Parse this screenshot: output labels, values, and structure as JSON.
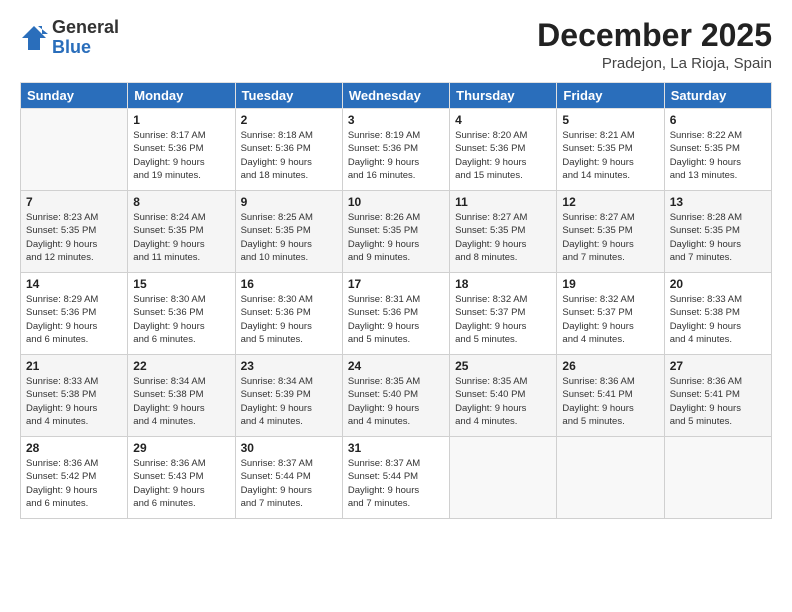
{
  "header": {
    "logo": {
      "line1": "General",
      "line2": "Blue"
    },
    "title": "December 2025",
    "location": "Pradejon, La Rioja, Spain"
  },
  "weekdays": [
    "Sunday",
    "Monday",
    "Tuesday",
    "Wednesday",
    "Thursday",
    "Friday",
    "Saturday"
  ],
  "weeks": [
    [
      {
        "day": "",
        "info": ""
      },
      {
        "day": "1",
        "info": "Sunrise: 8:17 AM\nSunset: 5:36 PM\nDaylight: 9 hours\nand 19 minutes."
      },
      {
        "day": "2",
        "info": "Sunrise: 8:18 AM\nSunset: 5:36 PM\nDaylight: 9 hours\nand 18 minutes."
      },
      {
        "day": "3",
        "info": "Sunrise: 8:19 AM\nSunset: 5:36 PM\nDaylight: 9 hours\nand 16 minutes."
      },
      {
        "day": "4",
        "info": "Sunrise: 8:20 AM\nSunset: 5:36 PM\nDaylight: 9 hours\nand 15 minutes."
      },
      {
        "day": "5",
        "info": "Sunrise: 8:21 AM\nSunset: 5:35 PM\nDaylight: 9 hours\nand 14 minutes."
      },
      {
        "day": "6",
        "info": "Sunrise: 8:22 AM\nSunset: 5:35 PM\nDaylight: 9 hours\nand 13 minutes."
      }
    ],
    [
      {
        "day": "7",
        "info": "Sunrise: 8:23 AM\nSunset: 5:35 PM\nDaylight: 9 hours\nand 12 minutes."
      },
      {
        "day": "8",
        "info": "Sunrise: 8:24 AM\nSunset: 5:35 PM\nDaylight: 9 hours\nand 11 minutes."
      },
      {
        "day": "9",
        "info": "Sunrise: 8:25 AM\nSunset: 5:35 PM\nDaylight: 9 hours\nand 10 minutes."
      },
      {
        "day": "10",
        "info": "Sunrise: 8:26 AM\nSunset: 5:35 PM\nDaylight: 9 hours\nand 9 minutes."
      },
      {
        "day": "11",
        "info": "Sunrise: 8:27 AM\nSunset: 5:35 PM\nDaylight: 9 hours\nand 8 minutes."
      },
      {
        "day": "12",
        "info": "Sunrise: 8:27 AM\nSunset: 5:35 PM\nDaylight: 9 hours\nand 7 minutes."
      },
      {
        "day": "13",
        "info": "Sunrise: 8:28 AM\nSunset: 5:35 PM\nDaylight: 9 hours\nand 7 minutes."
      }
    ],
    [
      {
        "day": "14",
        "info": "Sunrise: 8:29 AM\nSunset: 5:36 PM\nDaylight: 9 hours\nand 6 minutes."
      },
      {
        "day": "15",
        "info": "Sunrise: 8:30 AM\nSunset: 5:36 PM\nDaylight: 9 hours\nand 6 minutes."
      },
      {
        "day": "16",
        "info": "Sunrise: 8:30 AM\nSunset: 5:36 PM\nDaylight: 9 hours\nand 5 minutes."
      },
      {
        "day": "17",
        "info": "Sunrise: 8:31 AM\nSunset: 5:36 PM\nDaylight: 9 hours\nand 5 minutes."
      },
      {
        "day": "18",
        "info": "Sunrise: 8:32 AM\nSunset: 5:37 PM\nDaylight: 9 hours\nand 5 minutes."
      },
      {
        "day": "19",
        "info": "Sunrise: 8:32 AM\nSunset: 5:37 PM\nDaylight: 9 hours\nand 4 minutes."
      },
      {
        "day": "20",
        "info": "Sunrise: 8:33 AM\nSunset: 5:38 PM\nDaylight: 9 hours\nand 4 minutes."
      }
    ],
    [
      {
        "day": "21",
        "info": "Sunrise: 8:33 AM\nSunset: 5:38 PM\nDaylight: 9 hours\nand 4 minutes."
      },
      {
        "day": "22",
        "info": "Sunrise: 8:34 AM\nSunset: 5:38 PM\nDaylight: 9 hours\nand 4 minutes."
      },
      {
        "day": "23",
        "info": "Sunrise: 8:34 AM\nSunset: 5:39 PM\nDaylight: 9 hours\nand 4 minutes."
      },
      {
        "day": "24",
        "info": "Sunrise: 8:35 AM\nSunset: 5:40 PM\nDaylight: 9 hours\nand 4 minutes."
      },
      {
        "day": "25",
        "info": "Sunrise: 8:35 AM\nSunset: 5:40 PM\nDaylight: 9 hours\nand 4 minutes."
      },
      {
        "day": "26",
        "info": "Sunrise: 8:36 AM\nSunset: 5:41 PM\nDaylight: 9 hours\nand 5 minutes."
      },
      {
        "day": "27",
        "info": "Sunrise: 8:36 AM\nSunset: 5:41 PM\nDaylight: 9 hours\nand 5 minutes."
      }
    ],
    [
      {
        "day": "28",
        "info": "Sunrise: 8:36 AM\nSunset: 5:42 PM\nDaylight: 9 hours\nand 6 minutes."
      },
      {
        "day": "29",
        "info": "Sunrise: 8:36 AM\nSunset: 5:43 PM\nDaylight: 9 hours\nand 6 minutes."
      },
      {
        "day": "30",
        "info": "Sunrise: 8:37 AM\nSunset: 5:44 PM\nDaylight: 9 hours\nand 7 minutes."
      },
      {
        "day": "31",
        "info": "Sunrise: 8:37 AM\nSunset: 5:44 PM\nDaylight: 9 hours\nand 7 minutes."
      },
      {
        "day": "",
        "info": ""
      },
      {
        "day": "",
        "info": ""
      },
      {
        "day": "",
        "info": ""
      }
    ]
  ]
}
